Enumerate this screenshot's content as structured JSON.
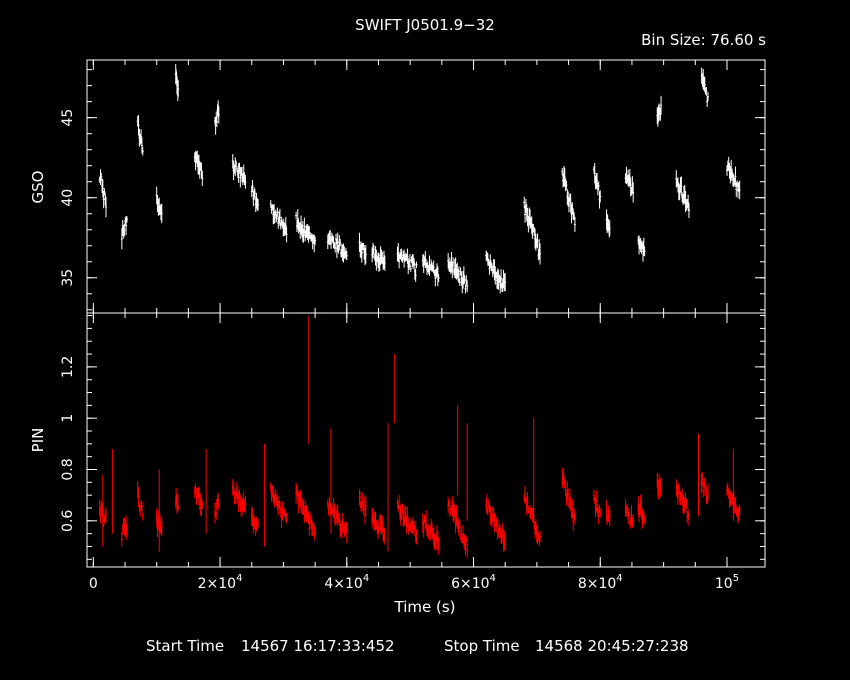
{
  "chart_data": {
    "type": "scatter",
    "title": "SWIFT J0501.9−32",
    "bin_size_label": "Bin Size: 76.60 s",
    "xlabel": "Time (s)",
    "x_ticks": [
      {
        "value": 0,
        "label": "0"
      },
      {
        "value": 20000,
        "label": "2×10",
        "exp": "4"
      },
      {
        "value": 40000,
        "label": "4×10",
        "exp": "4"
      },
      {
        "value": 60000,
        "label": "6×10",
        "exp": "4"
      },
      {
        "value": 80000,
        "label": "8×10",
        "exp": "4"
      },
      {
        "value": 100000,
        "label": "10",
        "exp": "5"
      }
    ],
    "xlim": [
      -1000,
      106000
    ],
    "panels": [
      {
        "name": "GSO",
        "ylabel": "GSO",
        "color": "#ffffff",
        "ylim": [
          32.8,
          48.6
        ],
        "y_ticks": [
          {
            "value": 35,
            "label": "35"
          },
          {
            "value": 40,
            "label": "40"
          },
          {
            "value": 45,
            "label": "45"
          }
        ],
        "segments": [
          {
            "x0": 1000,
            "x1": 2000,
            "y0": 41.5,
            "y1": 39.5
          },
          {
            "x0": 4500,
            "x1": 5300,
            "y0": 37.5,
            "y1": 38.8
          },
          {
            "x0": 7000,
            "x1": 7800,
            "y0": 44.8,
            "y1": 42.8
          },
          {
            "x0": 10000,
            "x1": 10800,
            "y0": 39.8,
            "y1": 39.0
          },
          {
            "x0": 13000,
            "x1": 13400,
            "y0": 47.8,
            "y1": 46.5
          },
          {
            "x0": 16000,
            "x1": 17200,
            "y0": 42.5,
            "y1": 41.5
          },
          {
            "x0": 19200,
            "x1": 19800,
            "y0": 44.5,
            "y1": 45.5
          },
          {
            "x0": 22000,
            "x1": 24000,
            "y0": 42.0,
            "y1": 41.0
          },
          {
            "x0": 25000,
            "x1": 26000,
            "y0": 40.5,
            "y1": 39.5
          },
          {
            "x0": 28000,
            "x1": 30500,
            "y0": 39.5,
            "y1": 38.0
          },
          {
            "x0": 32000,
            "x1": 35000,
            "y0": 38.5,
            "y1": 37.0
          },
          {
            "x0": 37000,
            "x1": 40000,
            "y0": 37.5,
            "y1": 36.5
          },
          {
            "x0": 42000,
            "x1": 43000,
            "y0": 37.0,
            "y1": 36.5
          },
          {
            "x0": 44000,
            "x1": 46000,
            "y0": 36.5,
            "y1": 35.8
          },
          {
            "x0": 48000,
            "x1": 51000,
            "y0": 36.5,
            "y1": 35.5
          },
          {
            "x0": 52000,
            "x1": 54500,
            "y0": 36.0,
            "y1": 35.0
          },
          {
            "x0": 56000,
            "x1": 59000,
            "y0": 36.0,
            "y1": 34.5
          },
          {
            "x0": 62000,
            "x1": 65000,
            "y0": 36.0,
            "y1": 34.5
          },
          {
            "x0": 68000,
            "x1": 70500,
            "y0": 39.5,
            "y1": 36.5
          },
          {
            "x0": 74000,
            "x1": 76000,
            "y0": 41.5,
            "y1": 38.5
          },
          {
            "x0": 79000,
            "x1": 80000,
            "y0": 41.5,
            "y1": 40.0
          },
          {
            "x0": 81000,
            "x1": 81500,
            "y0": 38.5,
            "y1": 38.0
          },
          {
            "x0": 84000,
            "x1": 85200,
            "y0": 41.5,
            "y1": 40.5
          },
          {
            "x0": 86000,
            "x1": 87000,
            "y0": 37.5,
            "y1": 36.5
          },
          {
            "x0": 89000,
            "x1": 89600,
            "y0": 45.0,
            "y1": 45.5
          },
          {
            "x0": 92000,
            "x1": 94000,
            "y0": 41.0,
            "y1": 39.5
          },
          {
            "x0": 96000,
            "x1": 97000,
            "y0": 48.0,
            "y1": 46.0
          },
          {
            "x0": 100000,
            "x1": 102000,
            "y0": 42.0,
            "y1": 40.5
          }
        ]
      },
      {
        "name": "PIN",
        "ylabel": "PIN",
        "color": "#ff0000",
        "ylim": [
          0.42,
          1.41
        ],
        "y_ticks": [
          {
            "value": 0.6,
            "label": "0.6"
          },
          {
            "value": 0.8,
            "label": "0.8"
          },
          {
            "value": 1,
            "label": "1"
          },
          {
            "value": 1.2,
            "label": "1.2"
          }
        ],
        "segments": [
          {
            "x0": 1000,
            "x1": 2000,
            "y0": 0.65,
            "y1": 0.6
          },
          {
            "x0": 4500,
            "x1": 5300,
            "y0": 0.55,
            "y1": 0.58
          },
          {
            "x0": 7000,
            "x1": 7800,
            "y0": 0.7,
            "y1": 0.62
          },
          {
            "x0": 10000,
            "x1": 10800,
            "y0": 0.6,
            "y1": 0.58
          },
          {
            "x0": 13000,
            "x1": 13400,
            "y0": 0.68,
            "y1": 0.65
          },
          {
            "x0": 16000,
            "x1": 17200,
            "y0": 0.72,
            "y1": 0.65
          },
          {
            "x0": 19200,
            "x1": 19800,
            "y0": 0.64,
            "y1": 0.66
          },
          {
            "x0": 22000,
            "x1": 24000,
            "y0": 0.72,
            "y1": 0.64
          },
          {
            "x0": 25000,
            "x1": 26000,
            "y0": 0.62,
            "y1": 0.58
          },
          {
            "x0": 28000,
            "x1": 30500,
            "y0": 0.72,
            "y1": 0.6
          },
          {
            "x0": 32000,
            "x1": 35000,
            "y0": 0.7,
            "y1": 0.55
          },
          {
            "x0": 37000,
            "x1": 40000,
            "y0": 0.66,
            "y1": 0.55
          },
          {
            "x0": 42000,
            "x1": 43000,
            "y0": 0.68,
            "y1": 0.64
          },
          {
            "x0": 44000,
            "x1": 46000,
            "y0": 0.62,
            "y1": 0.55
          },
          {
            "x0": 48000,
            "x1": 51000,
            "y0": 0.66,
            "y1": 0.55
          },
          {
            "x0": 52000,
            "x1": 54500,
            "y0": 0.6,
            "y1": 0.52
          },
          {
            "x0": 56000,
            "x1": 59000,
            "y0": 0.68,
            "y1": 0.5
          },
          {
            "x0": 62000,
            "x1": 65000,
            "y0": 0.66,
            "y1": 0.52
          },
          {
            "x0": 68000,
            "x1": 70500,
            "y0": 0.7,
            "y1": 0.52
          },
          {
            "x0": 74000,
            "x1": 76000,
            "y0": 0.76,
            "y1": 0.6
          },
          {
            "x0": 79000,
            "x1": 80000,
            "y0": 0.68,
            "y1": 0.62
          },
          {
            "x0": 81000,
            "x1": 81500,
            "y0": 0.62,
            "y1": 0.6
          },
          {
            "x0": 84000,
            "x1": 85200,
            "y0": 0.66,
            "y1": 0.58
          },
          {
            "x0": 86000,
            "x1": 87000,
            "y0": 0.66,
            "y1": 0.6
          },
          {
            "x0": 89000,
            "x1": 89600,
            "y0": 0.74,
            "y1": 0.72
          },
          {
            "x0": 92000,
            "x1": 94000,
            "y0": 0.74,
            "y1": 0.62
          },
          {
            "x0": 96000,
            "x1": 97000,
            "y0": 0.75,
            "y1": 0.7
          },
          {
            "x0": 100000,
            "x1": 102000,
            "y0": 0.72,
            "y1": 0.62
          }
        ],
        "spikes": [
          {
            "x": 1500,
            "y0": 0.5,
            "y1": 0.78
          },
          {
            "x": 3000,
            "y0": 0.55,
            "y1": 0.88
          },
          {
            "x": 10400,
            "y0": 0.48,
            "y1": 0.8
          },
          {
            "x": 17800,
            "y0": 0.55,
            "y1": 0.88
          },
          {
            "x": 27000,
            "y0": 0.5,
            "y1": 0.9
          },
          {
            "x": 34000,
            "y0": 0.9,
            "y1": 1.4
          },
          {
            "x": 37500,
            "y0": 0.55,
            "y1": 0.96
          },
          {
            "x": 46500,
            "y0": 0.48,
            "y1": 0.98
          },
          {
            "x": 47500,
            "y0": 0.98,
            "y1": 1.25
          },
          {
            "x": 57500,
            "y0": 0.7,
            "y1": 1.05
          },
          {
            "x": 59000,
            "y0": 0.6,
            "y1": 0.98
          },
          {
            "x": 69500,
            "y0": 0.6,
            "y1": 1.0
          },
          {
            "x": 95500,
            "y0": 0.62,
            "y1": 0.94
          },
          {
            "x": 101000,
            "y0": 0.6,
            "y1": 0.88
          }
        ]
      }
    ]
  },
  "footer": {
    "start_label": "Start Time",
    "start_value": "14567 16:17:33:452",
    "stop_label": "Stop Time",
    "stop_value": "14568 20:45:27:238"
  }
}
